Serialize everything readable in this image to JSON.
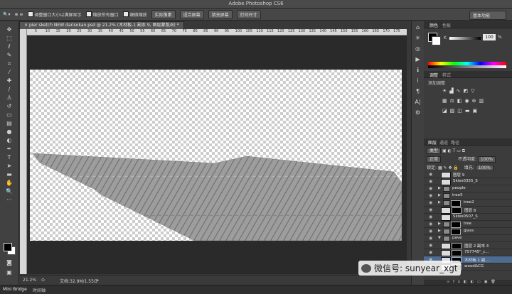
{
  "window": {
    "title": "Adobe Photoshop CS6"
  },
  "options_bar": {
    "tool_icon": "zoom-tool-icon",
    "resize_windows_label": "调整窗口大小以满屏显示",
    "zoom_all_windows_label": "缩放所有窗口",
    "scrubby_zoom_label": "细微缩放",
    "actual_pixels_label": "实际像素",
    "fit_screen_label": "适合屏幕",
    "fill_screen_label": "填充屏幕",
    "print_size_label": "打印尺寸",
    "workspace_label": "基本功能"
  },
  "document": {
    "tab_label": "pier sketch NEW darisokan.psd @ 21.2% (木材板-1 副本 9, 图层蒙版/8) *",
    "ruler_ticks": [
      "5",
      "10",
      "15",
      "20",
      "25",
      "30",
      "35",
      "40",
      "45",
      "50",
      "55",
      "60",
      "65",
      "70",
      "75",
      "80",
      "85",
      "90",
      "95",
      "100",
      "105",
      "110",
      "115",
      "120",
      "125",
      "130",
      "135",
      "140",
      "145",
      "150",
      "155",
      "160",
      "165",
      "170",
      "175"
    ],
    "zoom": "21.2%",
    "doc_size": "文档:32.9M/1.55G"
  },
  "bottom_tabs": {
    "mini_bridge": "Mini Bridge",
    "timeline": "时间轴"
  },
  "color_panel": {
    "tabs": [
      "颜色",
      "色板"
    ],
    "slider_channel": "K",
    "slider_value": "100",
    "percent": "%"
  },
  "adjustments_panel": {
    "tabs": [
      "调整",
      "样式"
    ],
    "add_adjustment_label": "添加调整"
  },
  "layers_panel": {
    "tabs": [
      "图层",
      "通道",
      "路径"
    ],
    "kind_label": "类型",
    "blend_mode": "正常",
    "opacity_label": "不透明度:",
    "opacity_value": "100%",
    "lock_label": "锁定:",
    "fill_label": "填充:",
    "fill_value": "100%",
    "layers": [
      {
        "name": "图层 9",
        "type": "layer"
      },
      {
        "name": "Skies0355_S",
        "type": "layer"
      },
      {
        "name": "people",
        "type": "group"
      },
      {
        "name": "tree5",
        "type": "group"
      },
      {
        "name": "tree2",
        "type": "group-mask"
      },
      {
        "name": "图层 8",
        "type": "layer-mask"
      },
      {
        "name": "Skies0507_S",
        "type": "layer"
      },
      {
        "name": "tree",
        "type": "group-mask"
      },
      {
        "name": "glass",
        "type": "group-mask"
      },
      {
        "name": "pave",
        "type": "group-open"
      },
      {
        "name": "图层 2 副本 4",
        "type": "layer-mask"
      },
      {
        "name": "757745\"_c...",
        "type": "layer-mask"
      },
      {
        "name": "木材板-1 副...",
        "type": "layer-mask",
        "selected": true
      },
      {
        "name": "wood&CG",
        "type": "layer-mask"
      }
    ]
  },
  "watermark": {
    "text": "微信号: sunyear_xgt"
  },
  "colors": {
    "app_bg": "#383838",
    "selection": "#4e6c91",
    "canvas_dark": "#2a2a2a"
  }
}
